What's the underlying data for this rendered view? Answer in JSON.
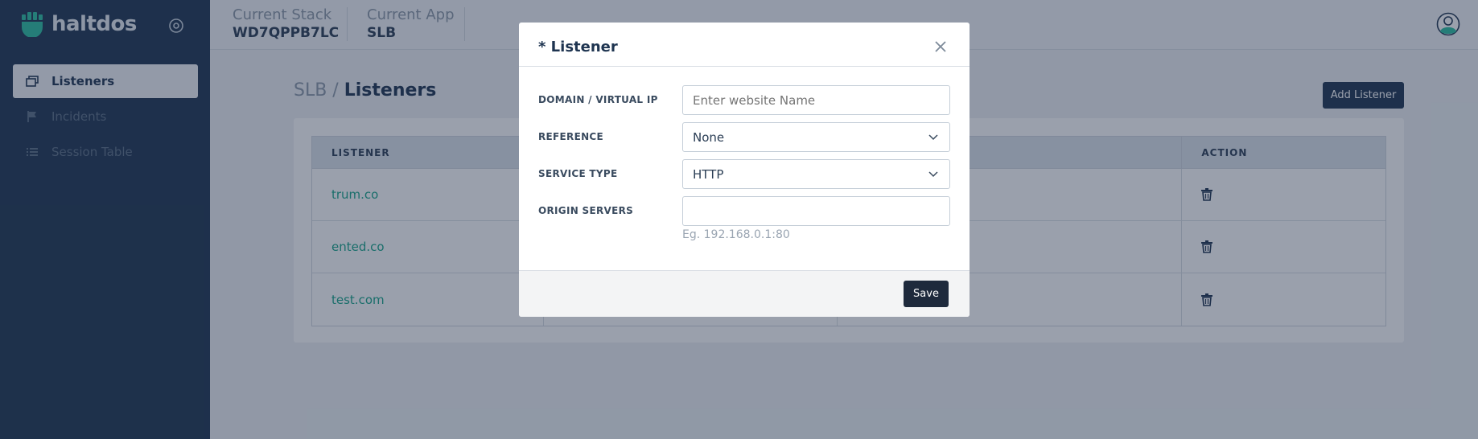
{
  "app": {
    "brand": "haltdos"
  },
  "sidebar": {
    "items": [
      {
        "label": "Listeners",
        "icon": "window-stack-icon",
        "active": true
      },
      {
        "label": "Incidents",
        "icon": "flag-icon",
        "active": false
      },
      {
        "label": "Session Table",
        "icon": "list-icon",
        "active": false
      }
    ]
  },
  "header": {
    "stack_label": "Current Stack",
    "stack_value": "WD7QPPB7LC",
    "app_label": "Current App",
    "app_value": "SLB"
  },
  "main": {
    "breadcrumb_parent": "SLB /",
    "breadcrumb_current": "Listeners",
    "add_button": "Add Listener",
    "table": {
      "columns": [
        "LISTENER",
        "",
        "",
        "ACTION"
      ],
      "rows": [
        {
          "listener": "trum.co"
        },
        {
          "listener": "ented.co"
        },
        {
          "listener": "test.com"
        }
      ]
    }
  },
  "modal": {
    "title": "* Listener",
    "fields": {
      "domain_label": "DOMAIN / VIRTUAL IP",
      "domain_placeholder": "Enter website Name",
      "reference_label": "REFERENCE",
      "reference_value": "None",
      "service_type_label": "SERVICE TYPE",
      "service_type_value": "HTTP",
      "origin_label": "ORIGIN SERVERS",
      "origin_value": "",
      "origin_hint": "Eg. 192.168.0.1:80"
    },
    "save_button": "Save"
  },
  "colors": {
    "sidebar_bg": "#1e3450",
    "link": "#17a589",
    "primary_button": "#1e3450"
  }
}
